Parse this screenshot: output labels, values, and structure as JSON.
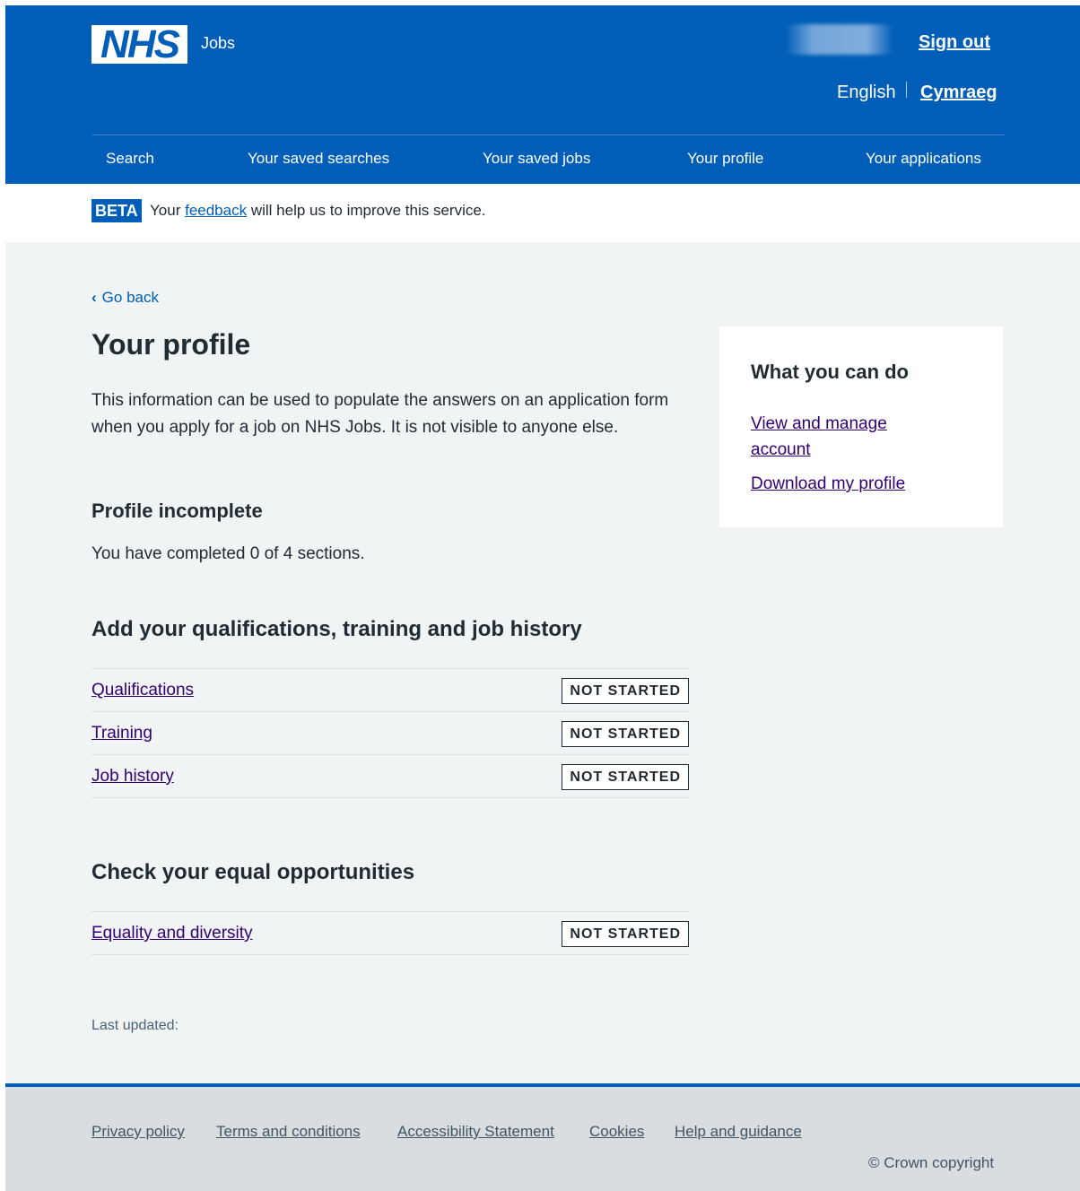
{
  "header": {
    "logo": "NHS",
    "service_name": "Jobs",
    "sign_out": "Sign out",
    "languages": {
      "english": "English",
      "welsh": "Cymraeg"
    },
    "nav": [
      "Search",
      "Your saved searches",
      "Your saved jobs",
      "Your profile",
      "Your applications"
    ],
    "colors": {
      "brand": "#005eb8",
      "link_visited": "#330072"
    }
  },
  "beta": {
    "tag": "BETA",
    "before": "Your",
    "link": "feedback",
    "after": "will help us to improve this service."
  },
  "main": {
    "back": "Go back",
    "title": "Your profile",
    "intro": "This information can be used to populate the answers on an application form when you apply for a job on NHS Jobs. It is not visible to anyone else.",
    "status_heading": "Profile incomplete",
    "completed_text": "You have completed 0 of 4 sections.",
    "section1": {
      "heading": "Add your qualifications, training and job history",
      "tasks": [
        {
          "label": "Qualifications",
          "status": "NOT STARTED"
        },
        {
          "label": "Training",
          "status": "NOT STARTED"
        },
        {
          "label": "Job history",
          "status": "NOT STARTED"
        }
      ]
    },
    "section2": {
      "heading": "Check your equal opportunities",
      "tasks": [
        {
          "label": "Equality and diversity",
          "status": "NOT STARTED"
        }
      ]
    },
    "last_updated": "Last updated:"
  },
  "sidebar": {
    "heading": "What you can do",
    "links": [
      "View and manage account",
      "Download my profile"
    ]
  },
  "footer": {
    "links": [
      "Privacy policy",
      "Terms and conditions",
      "Accessibility Statement",
      "Cookies",
      "Help and guidance"
    ],
    "copyright": "© Crown copyright"
  }
}
